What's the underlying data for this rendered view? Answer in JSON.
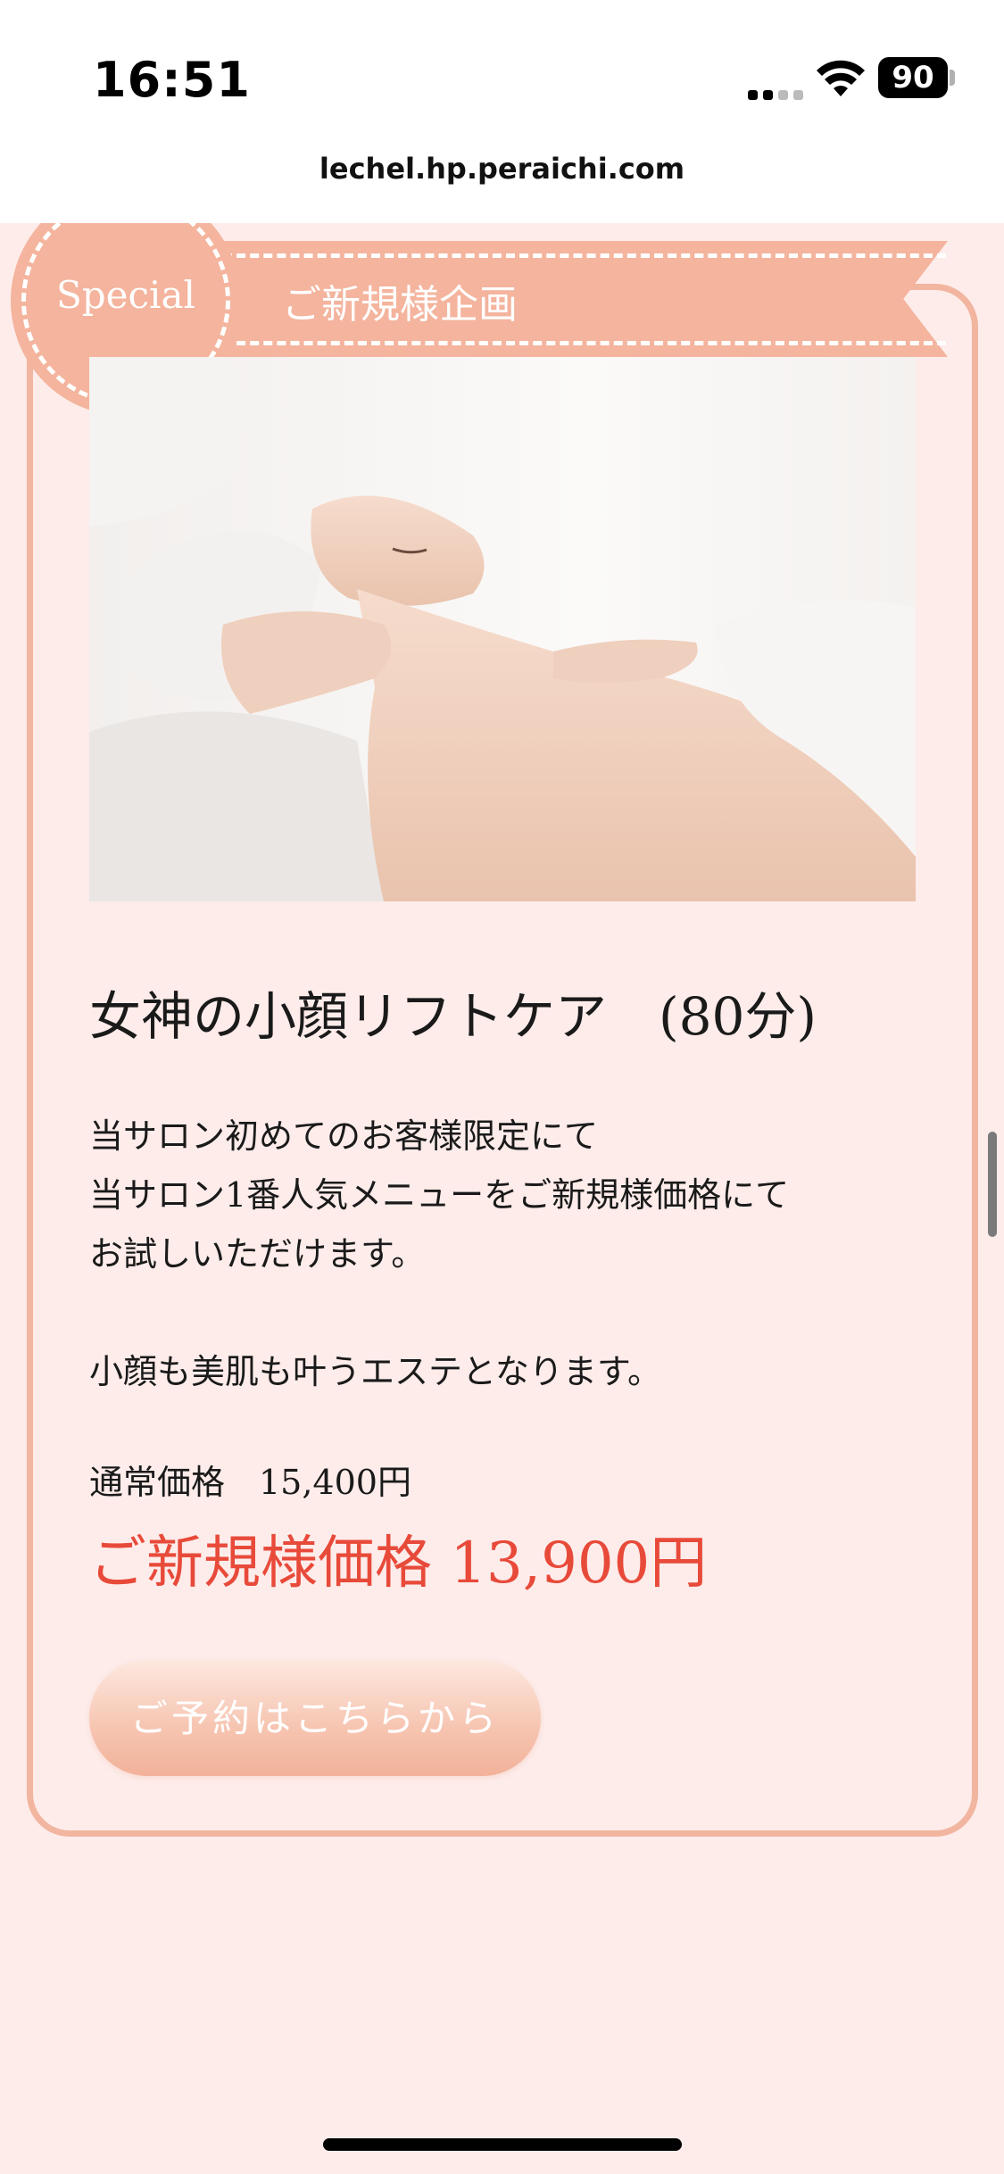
{
  "status_bar": {
    "time": "16:51",
    "battery": "90"
  },
  "browser": {
    "url": "lechel.hp.peraichi.com"
  },
  "section": {
    "badge_label": "Special",
    "ribbon_label": "ご新規様企画"
  },
  "menu": {
    "title": "女神の小顔リフトケア　(80分)",
    "description_lines": [
      "当サロン初めてのお客様限定にて",
      "当サロン1番人気メニューをご新規様価格にて",
      "お試しいただけます。",
      "小顔も美肌も叶うエステとなります。"
    ],
    "regular_price": "通常価格　15,400円",
    "new_price": "ご新規様価格  13,900円",
    "reserve_button_label": "ご予約はこちらから"
  },
  "colors": {
    "accent": "#f4b49d",
    "background": "#fdecea",
    "price_red": "#e84a3a"
  },
  "icons": [
    "signal-icon",
    "wifi-icon",
    "battery-icon"
  ]
}
